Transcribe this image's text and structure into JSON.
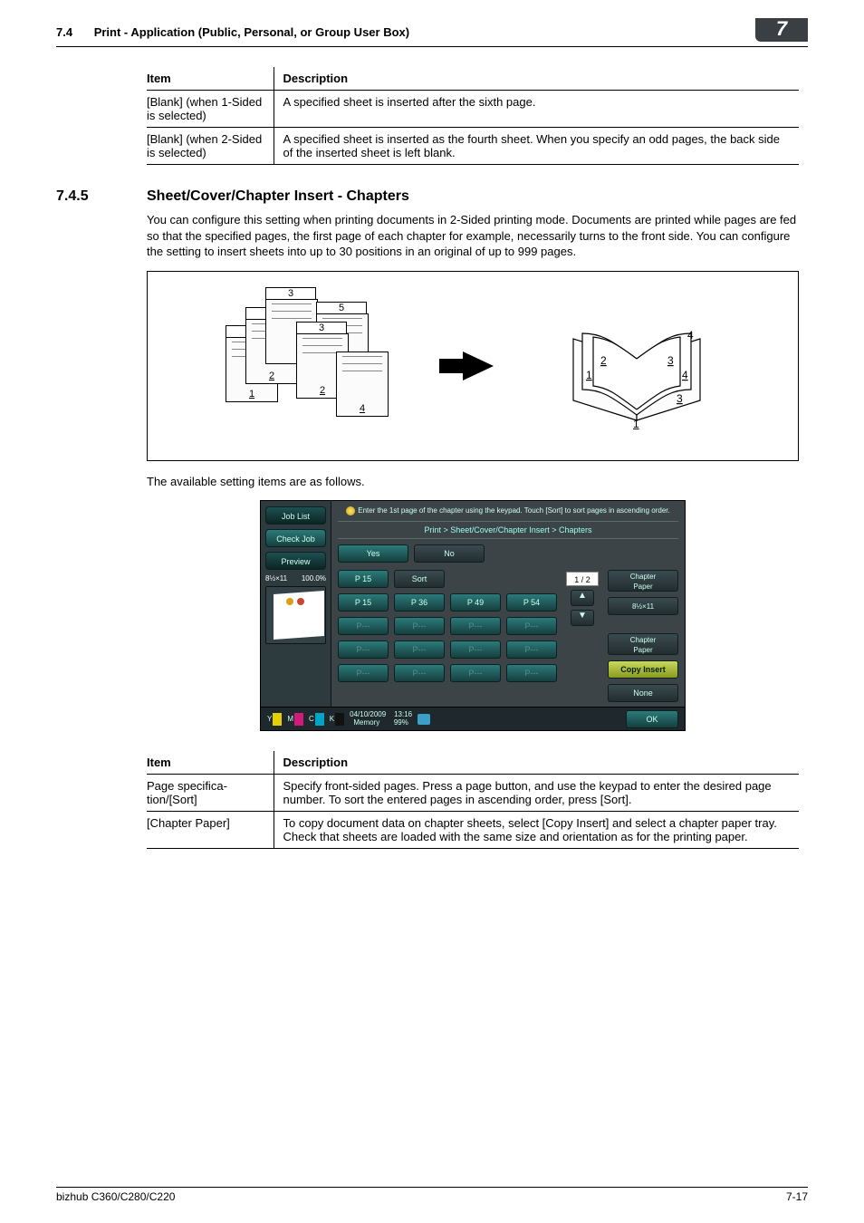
{
  "header": {
    "section": "7.4",
    "title": "Print - Application (Public, Personal, or Group User Box)",
    "chapter": "7"
  },
  "table1": {
    "head_item": "Item",
    "head_desc": "Description",
    "rows": [
      {
        "item": "[Blank] (when 1-Sided is selected)",
        "desc": "A specified sheet is inserted after the sixth page."
      },
      {
        "item": "[Blank] (when 2-Sided is selected)",
        "desc": "A specified sheet is inserted as the fourth sheet. When you specify an odd pages, the back side of the inserted sheet is left blank."
      }
    ]
  },
  "section": {
    "num": "7.4.5",
    "title": "Sheet/Cover/Chapter Insert - Chapters",
    "para1": "You can configure this setting when printing documents in 2-Sided printing mode. Documents are printed while pages are fed so that the specified pages, the first page of each chapter for example, necessarily turns to the front side. You can configure the setting to insert sheets into up to 30 positions in an original of up to 999 pages.",
    "para2": "The available setting items are as follows."
  },
  "diagram": {
    "left_sheets": {
      "s1": {
        "top": "1",
        "bottom": "1"
      },
      "s2": {
        "top": "2",
        "bottom": "2"
      },
      "s3": {
        "top": "3",
        "bottom": ""
      },
      "s4": {
        "top": "5",
        "bottom": "5"
      },
      "s5": {
        "top": "3",
        "bottom": "2"
      },
      "s6": {
        "top": "",
        "bottom": "4"
      }
    },
    "right_labels": [
      "1",
      "1",
      "2",
      "3",
      "4",
      "4",
      "3"
    ]
  },
  "panel": {
    "job_list": "Job List",
    "check_job": "Check Job",
    "preview": "Preview",
    "pct_left": "8½×11",
    "pct_right": "100.0%",
    "tip": "Enter the 1st page of the chapter using the keypad. Touch [Sort] to sort pages in ascending order.",
    "crumb": "Print > Sheet/Cover/Chapter Insert > Chapters",
    "yes": "Yes",
    "no": "No",
    "p15_top": "P  15",
    "sort": "Sort",
    "pagenum": "1 / 2",
    "pages": [
      "P  15",
      "P  36",
      "P  49",
      "P  54",
      "P---",
      "P---",
      "P---",
      "P---",
      "P---",
      "P---",
      "P---",
      "P---",
      "P---",
      "P---",
      "P---",
      "P---"
    ],
    "side_chapter_paper": "Chapter\nPaper",
    "side_tray": "8½×11",
    "side_chapter_paper2": "Chapter\nPaper",
    "copy_insert": "Copy Insert",
    "none": "None",
    "ok": "OK",
    "date": "04/10/2009",
    "time": "13:16",
    "mem": "Memory",
    "mempct": "99%",
    "ylabel": "Y",
    "mlabel": "M",
    "clabel": "C",
    "klabel": "K"
  },
  "table2": {
    "head_item": "Item",
    "head_desc": "Description",
    "rows": [
      {
        "item": "Page specifica­tion/[Sort]",
        "desc": "Specify front-sided pages. Press a page button, and use the keypad to enter the de­sired page number. To sort the entered pages in ascending order, press [Sort]."
      },
      {
        "item": "[Chapter Paper]",
        "desc": "To copy document data on chapter sheets, select [Copy Insert] and select a chapter paper tray. Check that sheets are loaded with the same size and orientation as for the printing paper."
      }
    ]
  },
  "footer": {
    "left": "bizhub C360/C280/C220",
    "right": "7-17"
  }
}
